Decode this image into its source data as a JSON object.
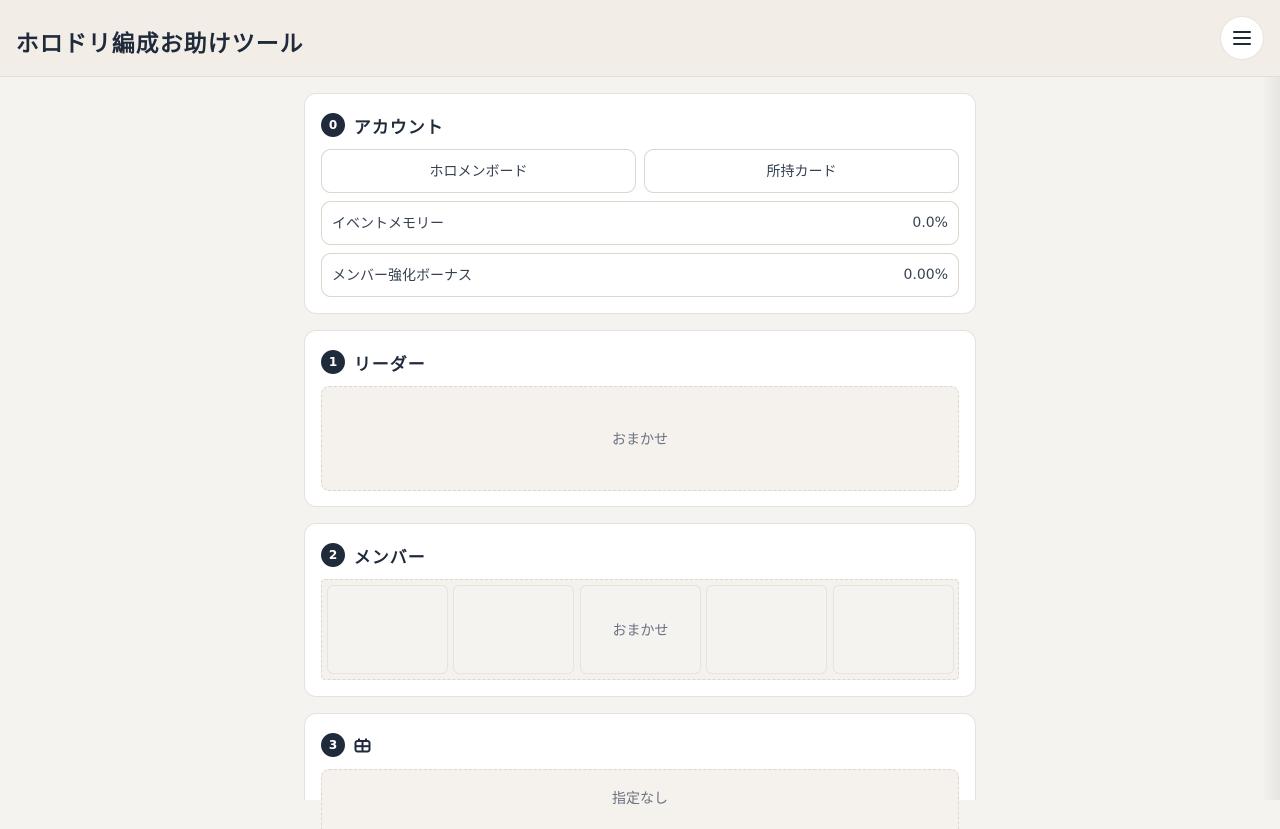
{
  "header": {
    "title": "ホロドリ編成お助けツール",
    "menu_icon": "hamburger-menu-icon"
  },
  "sections": {
    "account": {
      "step": "0",
      "title": "アカウント",
      "buttons": {
        "board": "ホロメンボード",
        "cards": "所持カード"
      },
      "fields": [
        {
          "label": "イベントメモリー",
          "value": "0.0%"
        },
        {
          "label": "メンバー強化ボーナス",
          "value": "0.00%"
        }
      ]
    },
    "leader": {
      "step": "1",
      "title": "リーダー",
      "slot_label": "おまかせ"
    },
    "members": {
      "step": "2",
      "title": "メンバー",
      "slots": [
        "",
        "",
        "おまかせ",
        "",
        ""
      ]
    },
    "ticket": {
      "step": "3",
      "icon": "ticket-grid-icon",
      "slot_label": "指定なし"
    }
  },
  "colors": {
    "accent": "#1f2a3a",
    "background": "#f5f3ef",
    "header_bg": "#f2ede7"
  }
}
